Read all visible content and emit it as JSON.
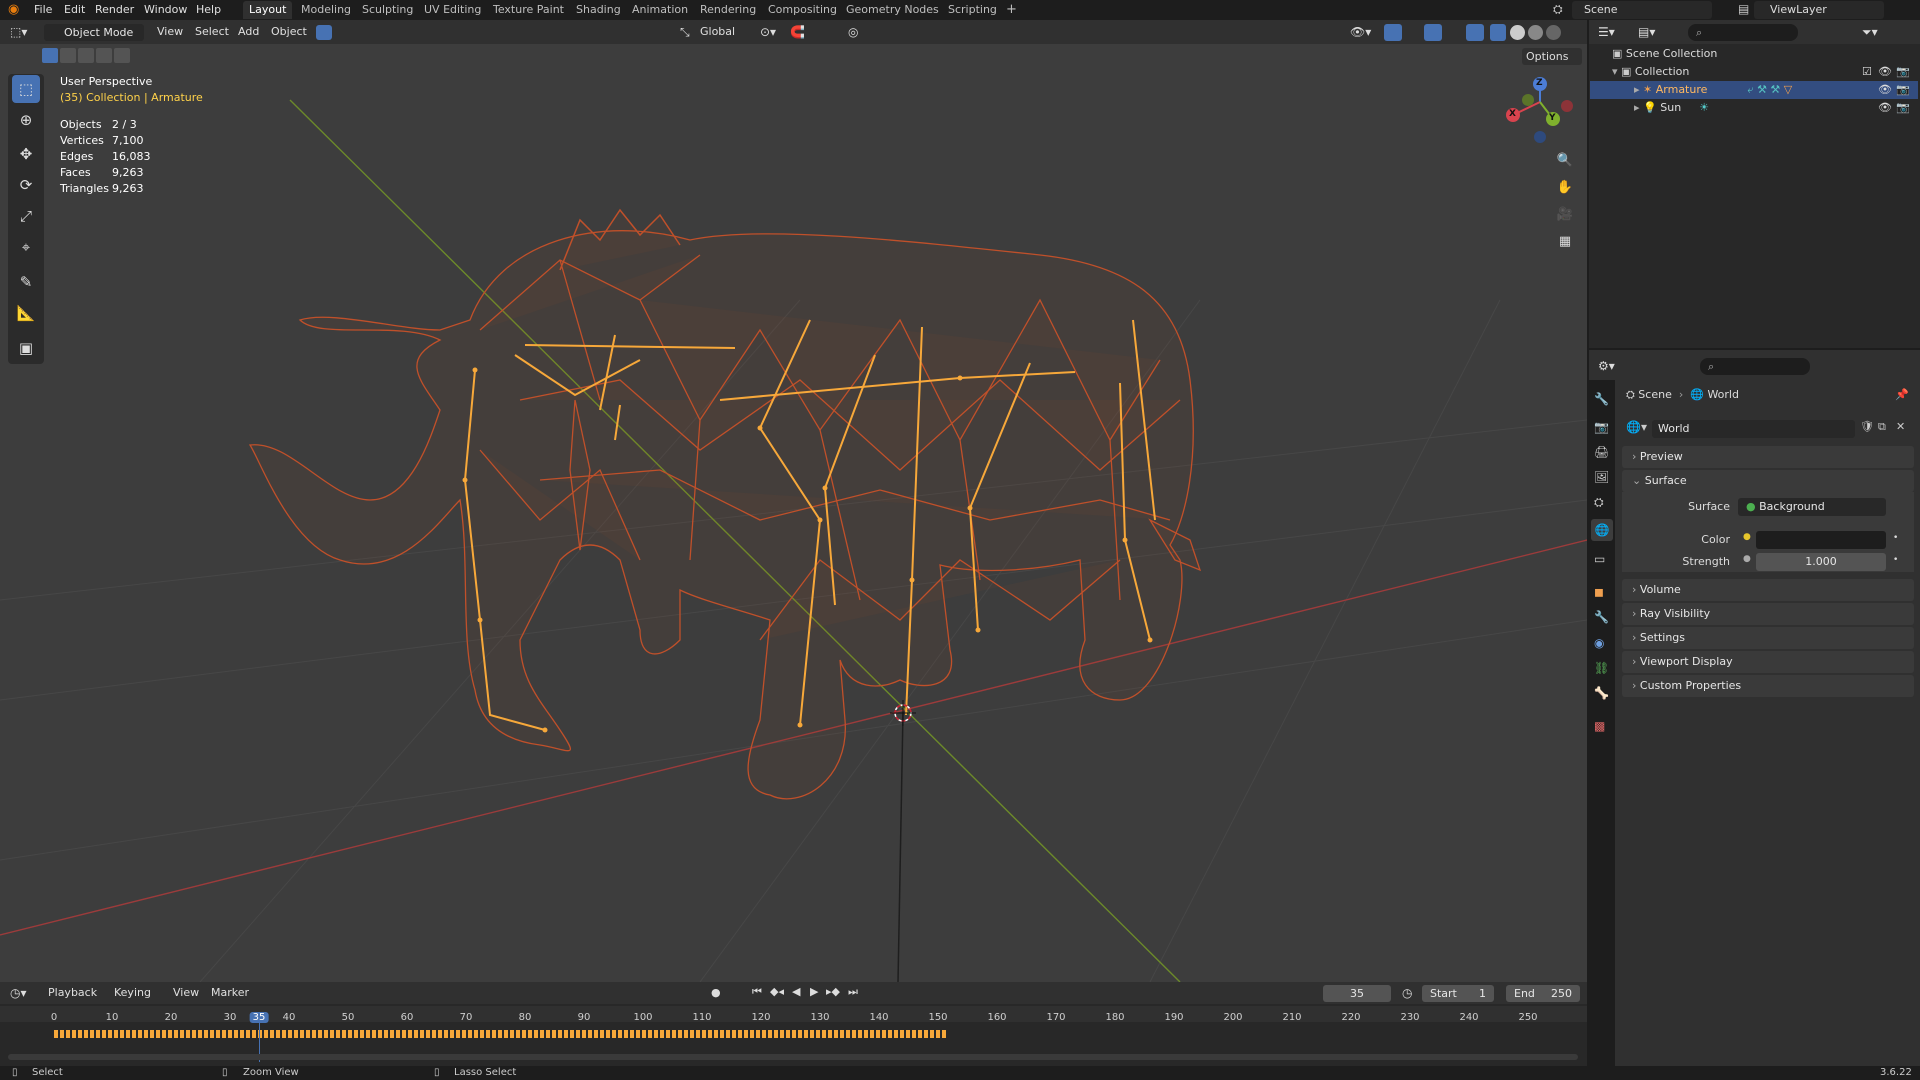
{
  "topbar": {
    "menus": [
      "File",
      "Edit",
      "Render",
      "Window",
      "Help"
    ],
    "workspaces": [
      "Layout",
      "Modeling",
      "Sculpting",
      "UV Editing",
      "Texture Paint",
      "Shading",
      "Animation",
      "Rendering",
      "Compositing",
      "Geometry Nodes",
      "Scripting"
    ],
    "active_workspace": "Layout",
    "add_tab": "+",
    "scene_name": "Scene",
    "view_layer": "ViewLayer"
  },
  "viewport_header": {
    "mode": "Object Mode",
    "menus": [
      "View",
      "Select",
      "Add",
      "Object"
    ],
    "transform_orientation": "Global",
    "options": "Options"
  },
  "viewport": {
    "view_name": "User Perspective",
    "context": "(35) Collection | Armature",
    "stats": [
      {
        "label": "Objects",
        "value": "2 / 3"
      },
      {
        "label": "Vertices",
        "value": "7,100"
      },
      {
        "label": "Edges",
        "value": "16,083"
      },
      {
        "label": "Faces",
        "value": "9,263"
      },
      {
        "label": "Triangles",
        "value": "9,263"
      }
    ],
    "gizmo": {
      "x": "X",
      "y": "Y",
      "z": "Z"
    }
  },
  "outliner": {
    "root": "Scene Collection",
    "collection": "Collection",
    "items": [
      {
        "name": "Armature",
        "selected": true
      },
      {
        "name": "Sun",
        "selected": false
      }
    ]
  },
  "properties": {
    "breadcrumb": [
      "Scene",
      "World"
    ],
    "world_name": "World",
    "panels": {
      "preview": "Preview",
      "surface": "Surface",
      "volume": "Volume",
      "ray_visibility": "Ray Visibility",
      "settings": "Settings",
      "viewport_display": "Viewport Display",
      "custom_properties": "Custom Properties"
    },
    "surface_label": "Surface",
    "surface_value": "Background",
    "color_label": "Color",
    "strength_label": "Strength",
    "strength_value": "1.000"
  },
  "timeline": {
    "menus": [
      "Playback",
      "Keying",
      "View",
      "Marker"
    ],
    "current_frame": "35",
    "start_label": "Start",
    "start_value": "1",
    "end_label": "End",
    "end_value": "250",
    "ticks": [
      "0",
      "10",
      "20",
      "30",
      "35",
      "40",
      "50",
      "60",
      "70",
      "80",
      "90",
      "100",
      "110",
      "120",
      "130",
      "140",
      "150",
      "160",
      "170",
      "180",
      "190",
      "200",
      "210",
      "220",
      "230",
      "240",
      "250"
    ]
  },
  "statusbar": {
    "select": "Select",
    "zoom": "Zoom View",
    "lasso": "Lasso Select",
    "version": "3.6.22"
  },
  "colors": {
    "accent": "#4772b3",
    "wire": "#c0502a",
    "bones": "#f7a83a",
    "xaxis": "#9c3b3b",
    "yaxis": "#6c8a2a"
  }
}
